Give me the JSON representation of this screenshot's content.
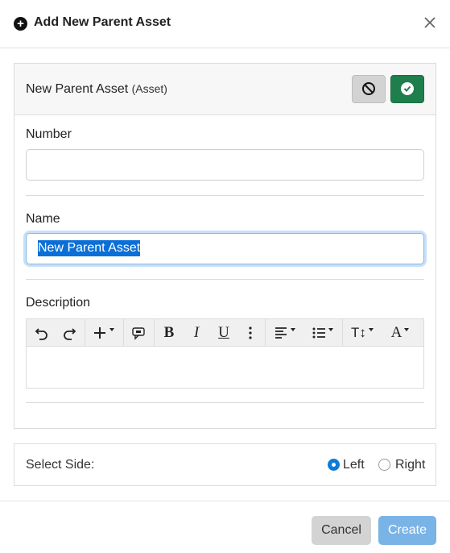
{
  "dialog": {
    "title": "Add New Parent Asset",
    "close_icon": "close-icon",
    "plus_icon": "plus-circle-icon"
  },
  "panel": {
    "title": "New Parent Asset",
    "subtitle": "(Asset)",
    "discard_icon": "ban-icon",
    "confirm_icon": "check-circle-icon"
  },
  "form": {
    "number_label": "Number",
    "number_value": "",
    "name_label": "Name",
    "name_value": "New Parent Asset",
    "description_label": "Description",
    "description_value": ""
  },
  "toolbar": {
    "items": [
      "undo-icon",
      "redo-icon",
      "insert-icon",
      "comment-icon",
      "bold-icon",
      "italic-icon",
      "underline-icon",
      "more-icon",
      "align-icon",
      "list-icon",
      "text-size-icon",
      "font-color-icon"
    ],
    "bold": "B",
    "italic": "I",
    "underline": "U",
    "text_size": "T↕",
    "font_color": "A"
  },
  "side": {
    "label": "Select Side:",
    "options": [
      "Left",
      "Right"
    ],
    "selected": "Left"
  },
  "footer": {
    "cancel_label": "Cancel",
    "create_label": "Create"
  },
  "colors": {
    "confirm_green": "#1e7e4c",
    "selection_blue": "#0a6fd6",
    "create_button": "#7ab3e6",
    "radio_blue": "#0d7bd8"
  }
}
